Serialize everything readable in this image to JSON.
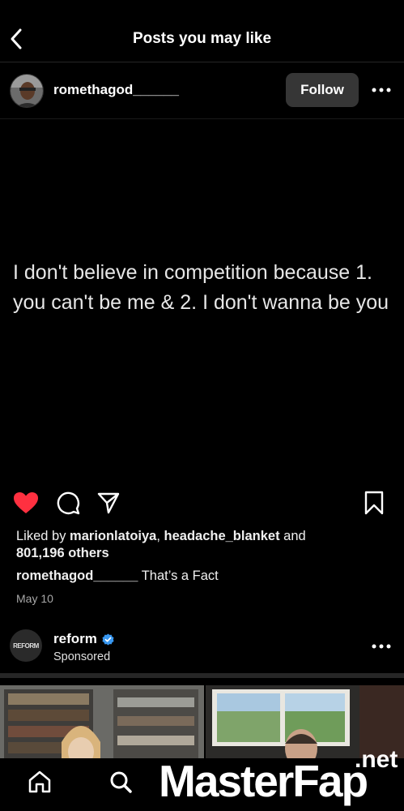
{
  "header": {
    "title": "Posts you may like"
  },
  "post": {
    "username": "romethagod______",
    "follow_label": "Follow",
    "text": "I don't believe in competition because 1. you can't be me & 2. I don't wanna be you",
    "likes_prefix": "Liked by ",
    "liked_by_1": "marionlatoiya",
    "liked_by_sep": ", ",
    "liked_by_2": "headache_blanket",
    "likes_and": " and",
    "likes_others": "801,196 others",
    "caption_user": "romethagod______",
    "caption_text": "That’s a Fact",
    "date": "May 10",
    "liked": true
  },
  "ad": {
    "name": "reform",
    "sponsored": "Sponsored",
    "logo_text": "REFORM",
    "verified": true
  },
  "watermark": {
    "brand": "MasterFap",
    "suffix": ".net"
  },
  "icons": {
    "back": "chevron-left-icon",
    "more": "more-horizontal-icon",
    "like": "heart-icon",
    "comment": "comment-icon",
    "share": "send-icon",
    "save": "bookmark-icon",
    "verified": "verified-badge-icon",
    "home": "home-icon",
    "search": "search-icon"
  },
  "colors": {
    "background": "#000000",
    "heart": "#ff3040",
    "verified": "#3897f0",
    "follow_button": "#363636",
    "muted_text": "#a8a8a8"
  }
}
